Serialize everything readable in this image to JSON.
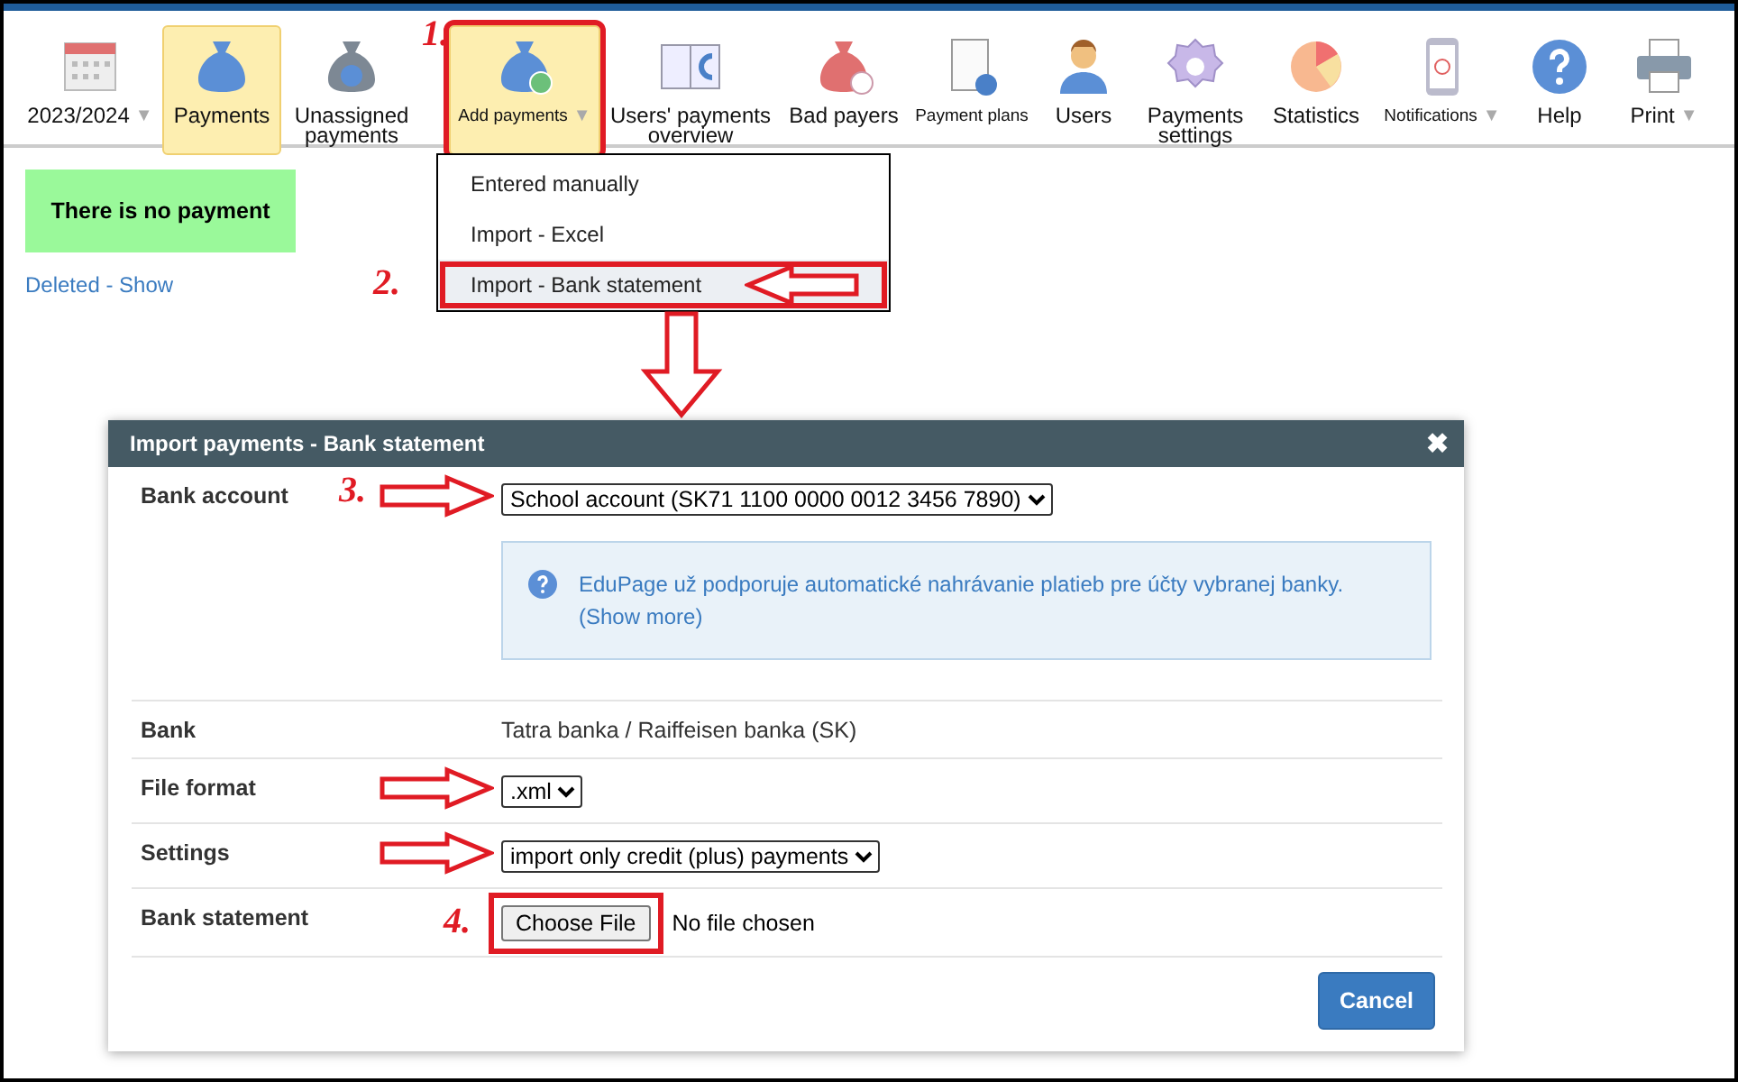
{
  "toolbar": {
    "items": [
      {
        "label": "2023/2024",
        "selected": false,
        "caret": "▼",
        "compact": false,
        "marked": false
      },
      {
        "label": "Payments",
        "selected": true,
        "compact": false,
        "marked": false
      },
      {
        "label": "Unassigned payments",
        "selected": false,
        "compact": false,
        "marked": false
      },
      {
        "label": "Add payments",
        "selected": true,
        "caret": "▼",
        "compact": true,
        "marked": true,
        "step": "1."
      },
      {
        "label": "Users' payments overview",
        "selected": false,
        "compact": false,
        "marked": false
      },
      {
        "label": "Bad payers",
        "selected": false,
        "compact": false,
        "marked": false
      },
      {
        "label": "Payment plans",
        "selected": false,
        "compact": true,
        "marked": false
      },
      {
        "label": "Users",
        "selected": false,
        "compact": false,
        "marked": false
      },
      {
        "label": "Payments settings",
        "selected": false,
        "compact": false,
        "marked": false
      },
      {
        "label": "Statistics",
        "selected": false,
        "compact": false,
        "marked": false
      },
      {
        "label": "Notifications",
        "selected": false,
        "caret": "▼",
        "compact": true,
        "marked": false
      },
      {
        "label": "Help",
        "selected": false,
        "compact": false,
        "marked": false
      },
      {
        "label": "Print",
        "selected": false,
        "caret": "▼",
        "compact": false,
        "marked": false
      }
    ]
  },
  "notice": "There is no payment",
  "deleted_link": "Deleted - Show",
  "menu": {
    "items": [
      {
        "label": "Entered manually",
        "selected": false,
        "marked": false
      },
      {
        "label": "Import - Excel",
        "selected": false,
        "marked": false
      },
      {
        "label": "Import - Bank statement",
        "selected": true,
        "marked": true,
        "step": "2."
      }
    ]
  },
  "dialog": {
    "title": "Import payments - Bank statement",
    "close": "✖",
    "rows": [
      {
        "kind": "select",
        "label": "Bank account",
        "value": "School account (SK71 1100 0000 0012 3456 7890)",
        "step": "3.",
        "pointer": true,
        "info": "EduPage už podporuje automatické nahrávanie platieb pre účty vybranej banky.",
        "info_link": "(Show more)"
      },
      {
        "kind": "text",
        "label": "Bank",
        "value": "Tatra banka / Raiffeisen banka (SK)",
        "pointer": false
      },
      {
        "kind": "select",
        "label": "File format",
        "value": ".xml",
        "pointer": true
      },
      {
        "kind": "select",
        "label": "Settings",
        "value": "import only credit (plus) payments",
        "pointer": true
      },
      {
        "kind": "file",
        "label": "Bank statement",
        "button": "Choose File",
        "value": "No file chosen",
        "step": "4.",
        "pointer": false,
        "marked": true
      }
    ],
    "buttons": [
      "Cancel"
    ]
  }
}
